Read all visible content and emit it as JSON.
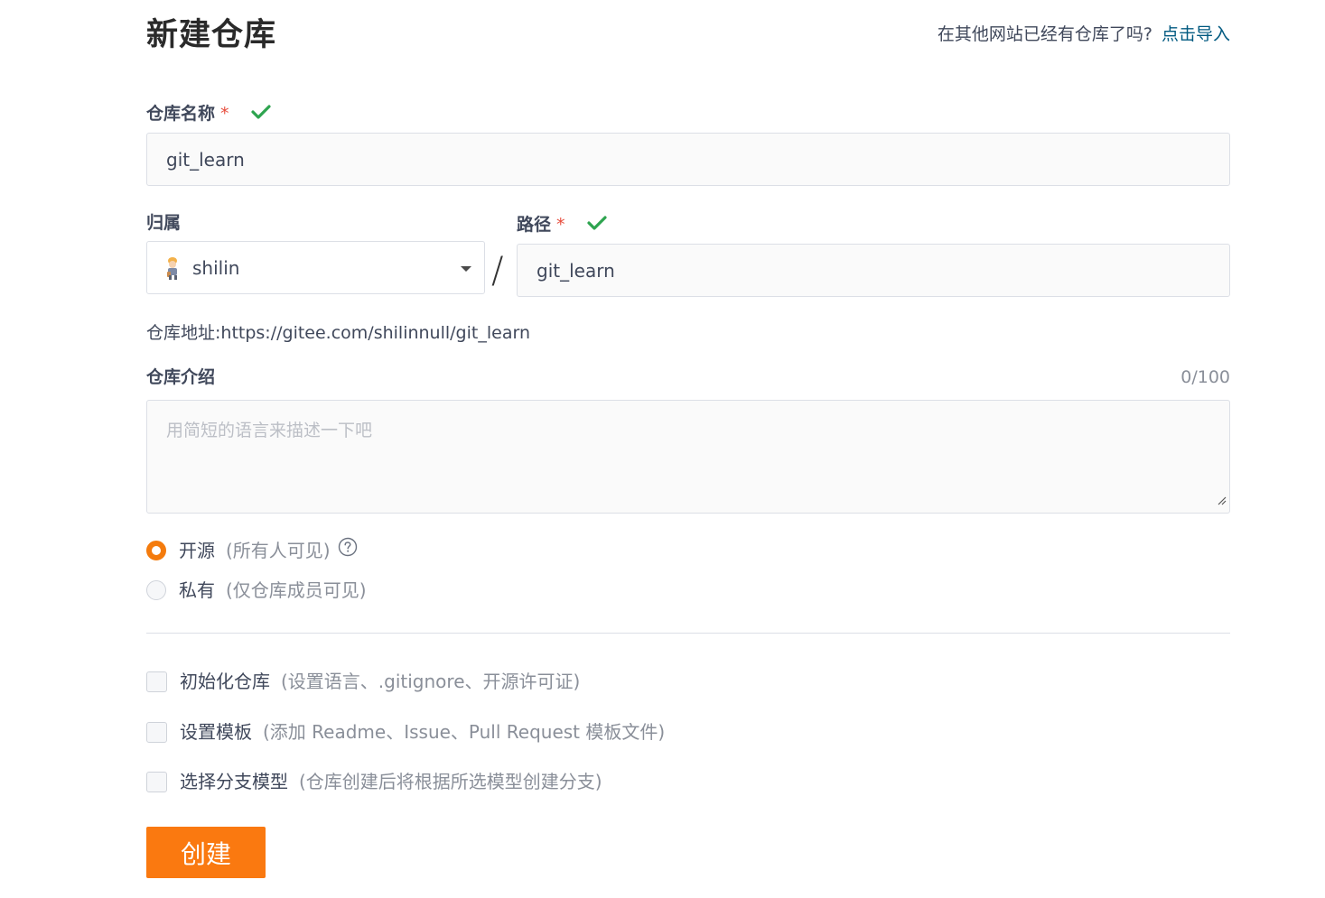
{
  "page_title": "新建仓库",
  "import_hint": {
    "text": "在其他网站已经有仓库了吗?",
    "link": "点击导入"
  },
  "repo_name": {
    "label": "仓库名称",
    "required_mark": "*",
    "value": "git_learn",
    "valid_icon": "check-icon"
  },
  "owner": {
    "label": "归属",
    "value": "shilin",
    "avatar_icon": "avatar-icon"
  },
  "separator": "/",
  "path": {
    "label": "路径",
    "required_mark": "*",
    "value": "git_learn",
    "valid_icon": "check-icon"
  },
  "address": {
    "label": "仓库地址:",
    "url": "https://gitee.com/shilinnull/git_learn"
  },
  "description": {
    "label": "仓库介绍",
    "counter": "0/100",
    "placeholder": "用简短的语言来描述一下吧"
  },
  "visibility": {
    "options": [
      {
        "label": "开源",
        "hint": "(所有人可见)",
        "selected": true,
        "help_icon": "question-circle-icon"
      },
      {
        "label": "私有",
        "hint": "(仅仓库成员可见)",
        "selected": false
      }
    ]
  },
  "options": [
    {
      "label": "初始化仓库",
      "hint": "(设置语言、.gitignore、开源许可证)",
      "checked": false
    },
    {
      "label": "设置模板",
      "hint": "(添加 Readme、Issue、Pull Request 模板文件)",
      "checked": false
    },
    {
      "label": "选择分支模型",
      "hint": "(仓库创建后将根据所选模型创建分支)",
      "checked": false
    }
  ],
  "submit_label": "创建",
  "colors": {
    "accent": "#fa7910",
    "link": "#005980",
    "valid": "#2ea44f",
    "required": "#e74c3c"
  }
}
